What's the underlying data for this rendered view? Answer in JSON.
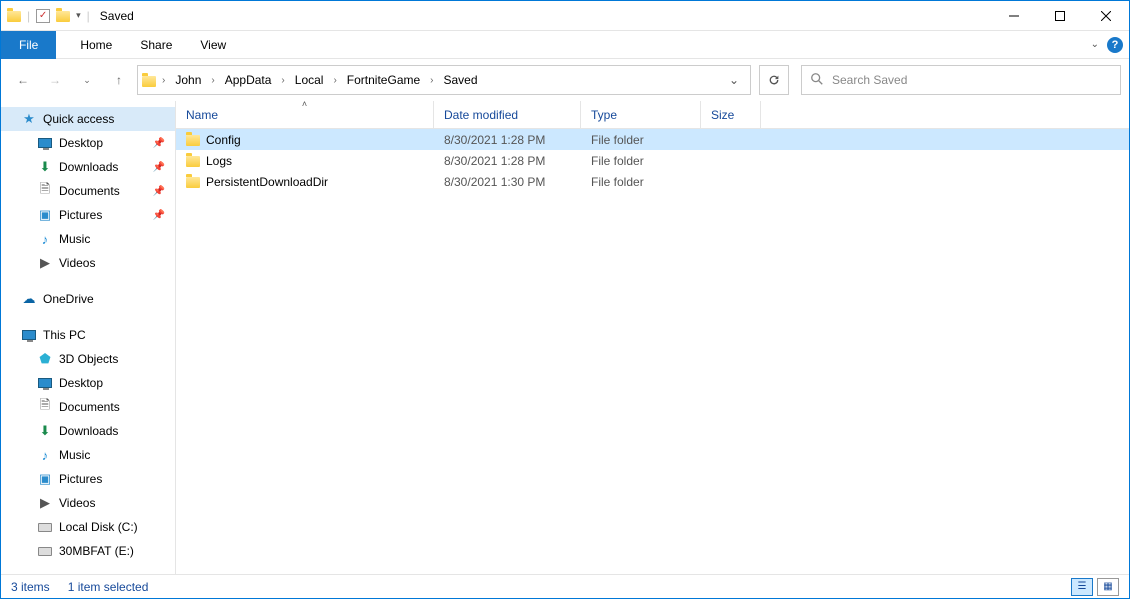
{
  "title": "Saved",
  "ribbon": {
    "file": "File",
    "home": "Home",
    "share": "Share",
    "view": "View"
  },
  "breadcrumbs": [
    "John",
    "AppData",
    "Local",
    "FortniteGame",
    "Saved"
  ],
  "search_placeholder": "Search Saved",
  "columns": {
    "name": "Name",
    "date": "Date modified",
    "type": "Type",
    "size": "Size"
  },
  "rows": [
    {
      "name": "Config",
      "date": "8/30/2021 1:28 PM",
      "type": "File folder",
      "selected": true
    },
    {
      "name": "Logs",
      "date": "8/30/2021 1:28 PM",
      "type": "File folder",
      "selected": false
    },
    {
      "name": "PersistentDownloadDir",
      "date": "8/30/2021 1:30 PM",
      "type": "File folder",
      "selected": false
    }
  ],
  "sidebar": {
    "quick_access": "Quick access",
    "desktop": "Desktop",
    "downloads": "Downloads",
    "documents": "Documents",
    "pictures": "Pictures",
    "music": "Music",
    "videos": "Videos",
    "onedrive": "OneDrive",
    "this_pc": "This PC",
    "objects3d": "3D Objects",
    "desktop2": "Desktop",
    "documents2": "Documents",
    "downloads2": "Downloads",
    "music2": "Music",
    "pictures2": "Pictures",
    "videos2": "Videos",
    "localdisk": "Local Disk (C:)",
    "fat": "30MBFAT (E:)"
  },
  "status": {
    "items": "3 items",
    "selected": "1 item selected"
  }
}
